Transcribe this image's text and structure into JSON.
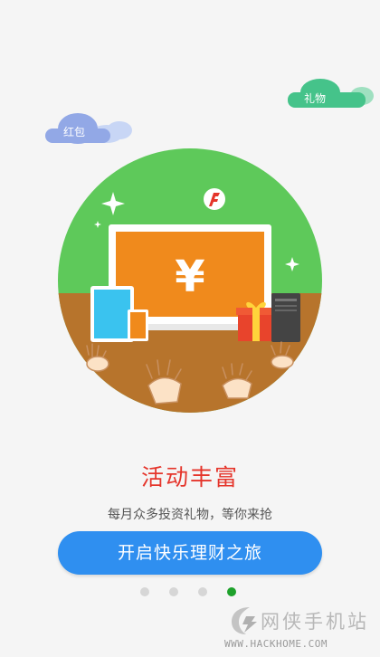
{
  "colors": {
    "background": "#f5f5f5",
    "title": "#e5352b",
    "cta_button": "#2f8ff0",
    "active_dot": "#1ea12b",
    "inactive_dot": "#d6d6d6",
    "circle_top": "#5ec95a",
    "ground": "#b7742c",
    "laptop_screen": "#f08a1c"
  },
  "clouds": {
    "red_packet": "红包",
    "gift": "礼物"
  },
  "illustration": {
    "screen_symbol": "¥"
  },
  "onboarding": {
    "title": "活动丰富",
    "subtitle": "每月众多投资礼物，等你来抢",
    "cta_label": "开启快乐理财之旅"
  },
  "pager": {
    "total": 4,
    "active_index": 3
  },
  "watermark": {
    "name": "网侠手机站",
    "url": "WWW.HACKHOME.COM"
  }
}
